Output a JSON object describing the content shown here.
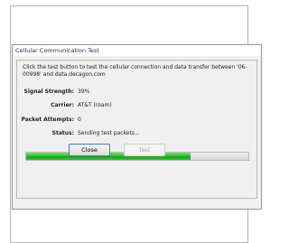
{
  "dialog": {
    "title": "Cellular Communication Test",
    "instructions": "Click the test button to test the cellular connection and data transfer between '06-00998' and data.decagon.com",
    "fields": [
      {
        "label": "Signal Strength:",
        "value": "39%"
      },
      {
        "label": "Carrier:",
        "value": "AT&T (roam)"
      },
      {
        "label": "Packet Attempts:",
        "value": "0"
      },
      {
        "label": "Status:",
        "value": "Sending test packets..."
      }
    ],
    "progress_fraction": 0.74,
    "buttons": {
      "close_label": "Close",
      "test_label": "Test"
    }
  },
  "colors": {
    "progress_green": "#2fc32c",
    "dialog_bg": "#f0f0f0",
    "default_button_border": "#3a7bd5"
  }
}
